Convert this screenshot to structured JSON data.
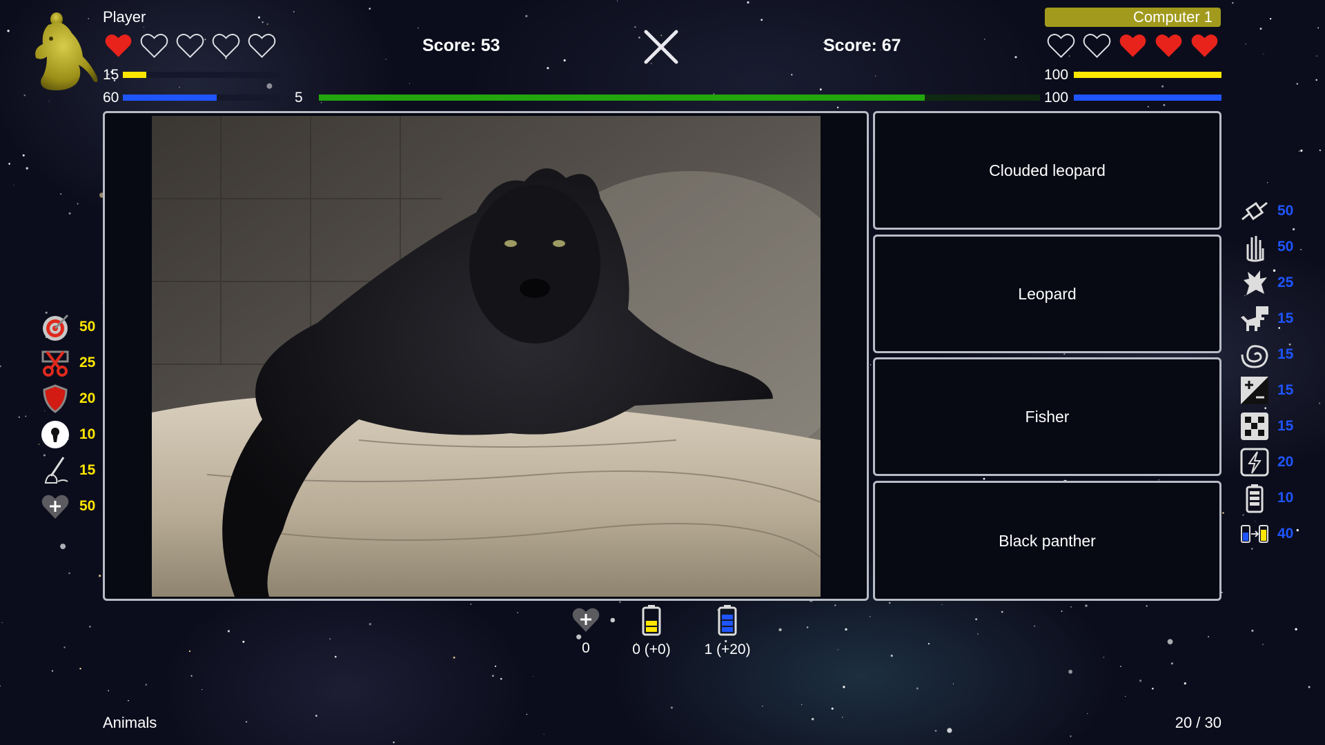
{
  "player": {
    "name": "Player",
    "score": "Score: 53",
    "hearts": [
      true,
      false,
      false,
      false,
      false
    ],
    "yellow_value": "15",
    "yellow_fraction": 0.15,
    "blue_value": "60",
    "blue_fraction": 0.6
  },
  "computer": {
    "name": "Computer 1",
    "score": "Score: 67",
    "hearts": [
      false,
      false,
      true,
      true,
      true
    ],
    "yellow_value": "100",
    "yellow_fraction": 1.0,
    "blue_value": "100",
    "blue_fraction": 1.0
  },
  "timer": {
    "value": "5",
    "fraction": 0.84
  },
  "colors": {
    "yellow": "#ffe600",
    "blue": "#1f55ff",
    "green": "#23a50e",
    "heart_red": "#e8231b",
    "computer_name_bg": "#a19a1d"
  },
  "question": {
    "image": "black-panther-photo"
  },
  "answers": [
    "Clouded leopard",
    "Leopard",
    "Fisher",
    "Black panther"
  ],
  "left_powerups": [
    {
      "icon": "target-icon",
      "value": "50"
    },
    {
      "icon": "scissors-icon",
      "value": "25"
    },
    {
      "icon": "shield-icon",
      "value": "20"
    },
    {
      "icon": "keyhole-icon",
      "value": "10"
    },
    {
      "icon": "broom-icon",
      "value": "15"
    },
    {
      "icon": "heart-plus-icon",
      "value": "50"
    }
  ],
  "right_powerups": [
    {
      "icon": "satellite-icon",
      "value": "50"
    },
    {
      "icon": "hand-icon",
      "value": "50"
    },
    {
      "icon": "dragon-icon",
      "value": "25"
    },
    {
      "icon": "dinosaur-icon",
      "value": "15"
    },
    {
      "icon": "spiral-icon",
      "value": "15"
    },
    {
      "icon": "plus-minus-icon",
      "value": "15"
    },
    {
      "icon": "dice-icon",
      "value": "15"
    },
    {
      "icon": "lightning-icon",
      "value": "20"
    },
    {
      "icon": "battery-icon",
      "value": "10"
    },
    {
      "icon": "battery-swap-icon",
      "value": "40"
    }
  ],
  "bottom": {
    "hearts": "0",
    "yellow_battery": "0 (+0)",
    "blue_battery": "1 (+20)"
  },
  "footer": {
    "category": "Animals",
    "progress": "20 / 30"
  }
}
